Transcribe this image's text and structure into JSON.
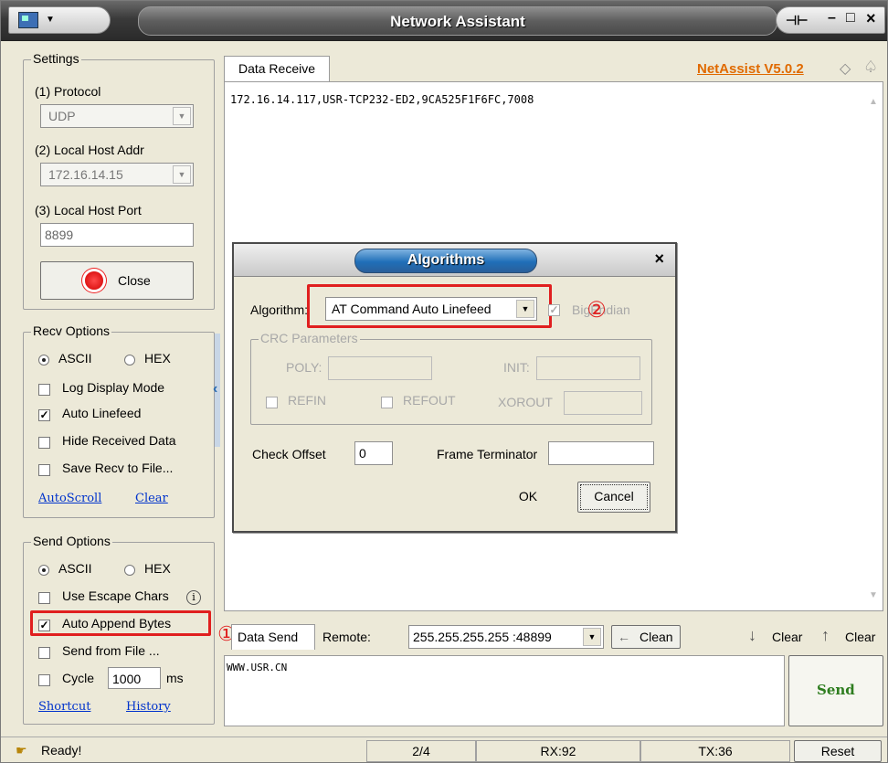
{
  "window": {
    "title": "Network Assistant"
  },
  "settings": {
    "legend": "Settings",
    "protocol_label": "(1) Protocol",
    "protocol_value": "UDP",
    "local_addr_label": "(2) Local Host Addr",
    "local_addr_value": "172.16.14.15",
    "local_port_label": "(3) Local Host Port",
    "local_port_value": "8899",
    "close_label": "Close"
  },
  "recv_options": {
    "legend": "Recv Options",
    "ascii": "ASCII",
    "hex": "HEX",
    "log_display": "Log Display Mode",
    "auto_linefeed": "Auto Linefeed",
    "hide_received": "Hide Received Data",
    "save_recv": "Save Recv to File...",
    "autoscroll": "AutoScroll",
    "clear": "Clear"
  },
  "send_options": {
    "legend": "Send Options",
    "ascii": "ASCII",
    "hex": "HEX",
    "escape_chars": "Use Escape Chars",
    "auto_append": "Auto Append Bytes",
    "send_from_file": "Send from File ...",
    "cycle": "Cycle",
    "cycle_value": "1000",
    "cycle_unit": "ms",
    "shortcut": "Shortcut",
    "history": "History"
  },
  "receive": {
    "tab_label": "Data Receive",
    "version_link": "NetAssist V5.0.2",
    "content": "172.16.14.117,USR-TCP232-ED2,9CA525F1F6FC,7008"
  },
  "send": {
    "tab_label": "Data Send",
    "remote_label": "Remote:",
    "remote_value": "255.255.255.255 :48899",
    "clean_label": "Clean",
    "clear1": "Clear",
    "clear2": "Clear",
    "content": "WWW.USR.CN",
    "send_button": "Send"
  },
  "dialog": {
    "title": "Algorithms",
    "algorithm_label": "Algorithm:",
    "algorithm_value": "AT Command Auto Linefeed",
    "big_endian": "BigEndian",
    "crc_legend": "CRC Parameters",
    "poly": "POLY:",
    "init": "INIT:",
    "refin": "REFIN",
    "refout": "REFOUT",
    "xorout": "XOROUT",
    "check_offset_label": "Check Offset",
    "check_offset_value": "0",
    "frame_terminator_label": "Frame Terminator",
    "ok": "OK",
    "cancel": "Cancel"
  },
  "annotations": {
    "one": "①",
    "two": "②"
  },
  "status": {
    "ready": "Ready!",
    "page": "2/4",
    "rx": "RX:92",
    "tx": "TX:36",
    "reset": "Reset"
  },
  "colors": {
    "annotation_red": "#e01f1f",
    "link_blue": "#0033cc",
    "version_orange": "#e06a00",
    "send_green": "#2e7d1f"
  }
}
